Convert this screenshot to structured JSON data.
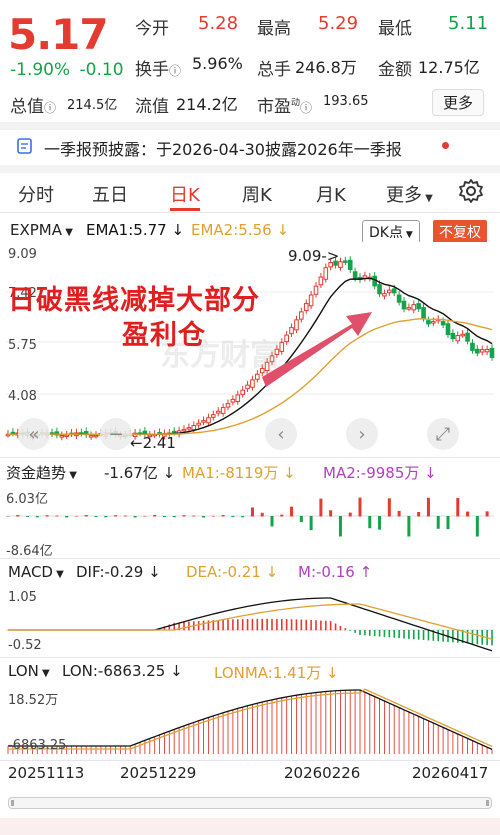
{
  "quote": {
    "price": "5.17",
    "change_pct": "-1.90%",
    "change_abs": "-0.10",
    "open_label": "今开",
    "open": "5.28",
    "high_label": "最高",
    "high": "5.29",
    "low_label": "最低",
    "low": "5.11",
    "turnover_label": "换手",
    "turnover": "5.96%",
    "volume_label": "总手",
    "volume": "246.8万",
    "amount_label": "金额",
    "amount": "12.75亿",
    "mktcap_label": "总值",
    "mktcap": "214.5亿",
    "float_label": "流值",
    "float": "214.2亿",
    "pe_label": "市盈",
    "pe_sup": "动",
    "pe": "193.65",
    "more": "更多"
  },
  "notice": {
    "text": "一季报预披露：于2026-04-30披露2026年一季报"
  },
  "tabs": {
    "items": [
      "分时",
      "五日",
      "日K",
      "周K",
      "月K",
      "更多"
    ],
    "active": "日K"
  },
  "kline": {
    "indicator": "EXPMA",
    "ema1": "EMA1:5.77 ↓",
    "ema2": "EMA2:5.56 ↓",
    "dk": "DK点",
    "fq": "不复权",
    "y_top": "9.09",
    "y_mid1": "7.42",
    "y_mid2": "5.75",
    "y_mid3": "4.08",
    "high_marker": "9.09->",
    "low_marker": "←2.41",
    "annotation_line1": "日破黑线减掉大部分",
    "annotation_line2": "盈利仓",
    "watermark": "东方财富"
  },
  "fund": {
    "indicator": "资金趋势",
    "value": "-1.67亿 ↓",
    "ma1": "MA1:-8119万 ↓",
    "ma2": "MA2:-9985万 ↓",
    "y_top": "6.03亿",
    "y_bot": "-8.64亿"
  },
  "macd": {
    "indicator": "MACD",
    "dif": "DIF:-0.29 ↓",
    "dea": "DEA:-0.21 ↓",
    "m": "M:-0.16 ↑",
    "y_top": "1.05",
    "y_bot": "-0.52"
  },
  "lon": {
    "indicator": "LON",
    "lon": "LON:-6863.25 ↓",
    "lonma": "LONMA:1.41万 ↓",
    "y_top": "18.52万",
    "y_bot": "-6863.25"
  },
  "dates": [
    "20251113",
    "20251229",
    "20260226",
    "20260417"
  ],
  "colors": {
    "up": "#e33b2f",
    "down": "#15a34a",
    "ema1": "#111111",
    "ema2": "#e0a030",
    "accent": "#e33b2f"
  }
}
